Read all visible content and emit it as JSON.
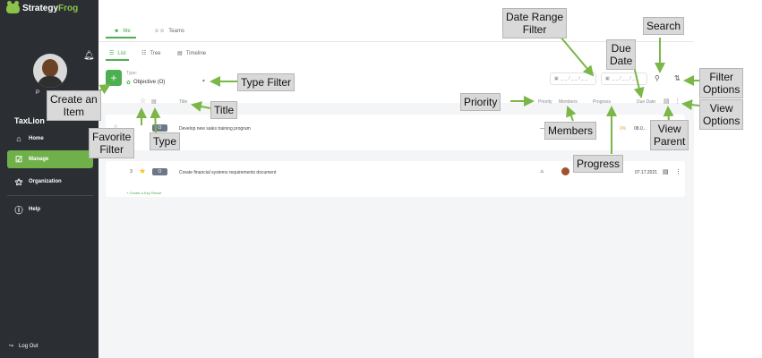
{
  "sidebar": {
    "logo_prefix": "Strategy",
    "logo_accent": "Frog",
    "user_initial": "P",
    "org_name": "TaxLion",
    "nav": [
      {
        "label": "Home",
        "icon": "home-icon"
      },
      {
        "label": "Manage",
        "icon": "manage-icon"
      },
      {
        "label": "Organization",
        "icon": "organization-icon"
      },
      {
        "label": "Help",
        "icon": "help-icon"
      }
    ],
    "logout_label": "Log Out"
  },
  "tabs": {
    "me": "Me",
    "teams": "Teams"
  },
  "subtabs": {
    "list": "List",
    "tree": "Tree",
    "timeline": "Timeline"
  },
  "filters": {
    "type_label": "Type:",
    "type_value": "Objective (O)",
    "date_from": "_ _ / _ _ / _ _",
    "date_to": "_ _ / _ _ / _ _"
  },
  "columns": {
    "title": "Title",
    "priority": "Priority",
    "members": "Members",
    "progress": "Progress",
    "due_date": "Due Date"
  },
  "rows": [
    {
      "title": "Develop new sales training program",
      "badge": "O",
      "progress": "0%",
      "due_date": "08.0..."
    },
    {
      "number": "3",
      "badge": "O",
      "title": "Create financial systems requirements document",
      "due_date": "07.17.2021"
    }
  ],
  "create_key_result": "+ Create a Key Result",
  "annotations": {
    "date_range_filter": "Date Range\nFilter",
    "search": "Search",
    "due_date": "Due\nDate",
    "filter_options": "Filter\nOptions",
    "type_filter": "Type Filter",
    "create_item": "Create an\nItem",
    "title": "Title",
    "priority": "Priority",
    "view_options": "View\nOptions",
    "favorite_filter": "Favorite\nFilter",
    "type": "Type",
    "members": "Members",
    "view_parent": "View\nParent",
    "progress": "Progress"
  },
  "colors": {
    "sidebar_bg": "#2b2f33",
    "accent_green": "#4caf50",
    "arrow_green": "#7ab648",
    "callout_bg": "#d9d9d9",
    "star_yellow": "#f5c518",
    "badge_grey": "#6e7787"
  }
}
